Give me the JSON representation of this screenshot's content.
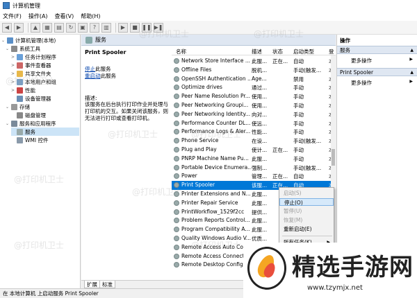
{
  "window": {
    "title": "计算机管理"
  },
  "menu": [
    "文件(F)",
    "操作(A)",
    "查看(V)",
    "帮助(H)"
  ],
  "tree": [
    {
      "label": "计算机管理(本地)",
      "level": 0,
      "arrow": "⌄"
    },
    {
      "label": "系统工具",
      "level": 1,
      "arrow": "⌄"
    },
    {
      "label": "任务计划程序",
      "level": 2,
      "arrow": ">"
    },
    {
      "label": "事件查看器",
      "level": 2,
      "arrow": ">"
    },
    {
      "label": "共享文件夹",
      "level": 2,
      "arrow": ">"
    },
    {
      "label": "本地用户和组",
      "level": 2,
      "arrow": ">"
    },
    {
      "label": "性能",
      "level": 2,
      "arrow": ">"
    },
    {
      "label": "设备管理器",
      "level": 2,
      "arrow": ""
    },
    {
      "label": "存储",
      "level": 1,
      "arrow": "⌄"
    },
    {
      "label": "磁盘管理",
      "level": 2,
      "arrow": ""
    },
    {
      "label": "服务和应用程序",
      "level": 1,
      "arrow": "⌄"
    },
    {
      "label": "服务",
      "level": 2,
      "arrow": "",
      "selected": true
    },
    {
      "label": "WMI 控件",
      "level": 2,
      "arrow": ""
    }
  ],
  "pane_header": "服务",
  "details": {
    "title": "Print Spooler",
    "stop_link": "停止",
    "stop_suffix": "此服务",
    "restart_link": "重启动",
    "restart_suffix": "此服务",
    "desc_label": "描述:",
    "desc_text": "该服务在后台执行打印作业并处理与打印机的交互。如果关闭该服务，则无法进行打印或查看打印机。"
  },
  "columns": [
    "名称",
    "描述",
    "状态",
    "启动类型",
    "登"
  ],
  "services": [
    {
      "name": "Network Store Interface ...",
      "desc": "此服...",
      "status": "正在...",
      "startup": "自动",
      "logon": "本"
    },
    {
      "name": "Offline Files",
      "desc": "脱机...",
      "status": "",
      "startup": "手动(触发...",
      "logon": "本"
    },
    {
      "name": "OpenSSH Authentication ...",
      "desc": "Age...",
      "status": "",
      "startup": "禁用",
      "logon": "本"
    },
    {
      "name": "Optimize drives",
      "desc": "通过...",
      "status": "",
      "startup": "手动",
      "logon": "本"
    },
    {
      "name": "Peer Name Resolution Pr...",
      "desc": "使用...",
      "status": "",
      "startup": "手动",
      "logon": "本"
    },
    {
      "name": "Peer Networking Groupi...",
      "desc": "使用...",
      "status": "",
      "startup": "手动",
      "logon": "本"
    },
    {
      "name": "Peer Networking Identity...",
      "desc": "向对...",
      "status": "",
      "startup": "手动",
      "logon": "本"
    },
    {
      "name": "Performance Counter DL...",
      "desc": "使远...",
      "status": "",
      "startup": "手动",
      "logon": "本"
    },
    {
      "name": "Performance Logs & Aler...",
      "desc": "性能...",
      "status": "",
      "startup": "手动",
      "logon": "本"
    },
    {
      "name": "Phone Service",
      "desc": "在设...",
      "status": "",
      "startup": "手动(触发...",
      "logon": "本"
    },
    {
      "name": "Plug and Play",
      "desc": "使计...",
      "status": "正在...",
      "startup": "手动",
      "logon": "本"
    },
    {
      "name": "PNRP Machine Name Pu...",
      "desc": "此服...",
      "status": "",
      "startup": "手动",
      "logon": "本"
    },
    {
      "name": "Portable Device Enumera...",
      "desc": "强制...",
      "status": "",
      "startup": "手动(触发...",
      "logon": "本"
    },
    {
      "name": "Power",
      "desc": "管理...",
      "status": "正在...",
      "startup": "自动",
      "logon": "本"
    },
    {
      "name": "Print Spooler",
      "desc": "该服...",
      "status": "正在...",
      "startup": "自动",
      "logon": "本",
      "selected": true
    },
    {
      "name": "Printer Extensions and N...",
      "desc": "此服...",
      "status": "",
      "startup": "",
      "logon": ""
    },
    {
      "name": "Printer Repair Service",
      "desc": "此服...",
      "status": "",
      "startup": "",
      "logon": ""
    },
    {
      "name": "PrintWorkflow_1529f2cc",
      "desc": "提供...",
      "status": "",
      "startup": "",
      "logon": ""
    },
    {
      "name": "Problem Reports Control...",
      "desc": "此服...",
      "status": "",
      "startup": "",
      "logon": ""
    },
    {
      "name": "Program Compatibility A...",
      "desc": "此服...",
      "status": "",
      "startup": "",
      "logon": ""
    },
    {
      "name": "Quality Windows Audio V...",
      "desc": "优质...",
      "status": "",
      "startup": "",
      "logon": ""
    },
    {
      "name": "Remote Access Auto Con...",
      "desc": "无论...",
      "status": "",
      "startup": "",
      "logon": ""
    },
    {
      "name": "Remote Access Connecti...",
      "desc": "管理...",
      "status": "",
      "startup": "",
      "logon": ""
    },
    {
      "name": "Remote Desktop Configu...",
      "desc": "远程...",
      "status": "",
      "startup": "",
      "logon": ""
    }
  ],
  "tabs": [
    "扩展",
    "标准"
  ],
  "actions": {
    "header": "操作",
    "group1": "服务",
    "group1_more": "更多操作",
    "group2": "Print Spooler",
    "group2_more": "更多操作"
  },
  "context_menu": [
    {
      "label": "启动(S)",
      "disabled": true
    },
    {
      "label": "停止(O)",
      "highlight": true
    },
    {
      "label": "暂停(U)",
      "disabled": true
    },
    {
      "label": "恢复(M)",
      "disabled": true
    },
    {
      "label": "重新启动(E)"
    },
    {
      "sep": true
    },
    {
      "label": "所有任务(K)",
      "submenu": true
    }
  ],
  "status_bar": "在 本地计算机 上启动服务 Print Spooler",
  "watermark": "@打印机卫士",
  "badge": {
    "text": "精选手游网",
    "url": "www.tzymjx.net"
  },
  "colors": {
    "selection": "#0078d7",
    "header_band": "#dfe7f2",
    "link": "#0645ad"
  }
}
